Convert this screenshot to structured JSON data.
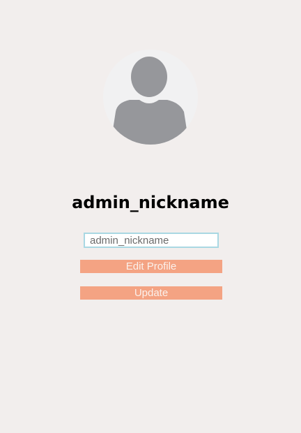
{
  "profile": {
    "avatar_icon": "user-silhouette-icon",
    "display_name": "admin_nickname"
  },
  "form": {
    "nickname_value": "admin_nickname",
    "edit_label": "Edit Profile",
    "update_label": "Update"
  },
  "colors": {
    "page_background": "#f2eeed",
    "avatar_background": "#f1f1f2",
    "avatar_silhouette": "#96979b",
    "button_background": "#f4a383",
    "button_text": "#fbf1ec",
    "input_border": "#a9d8e3"
  }
}
